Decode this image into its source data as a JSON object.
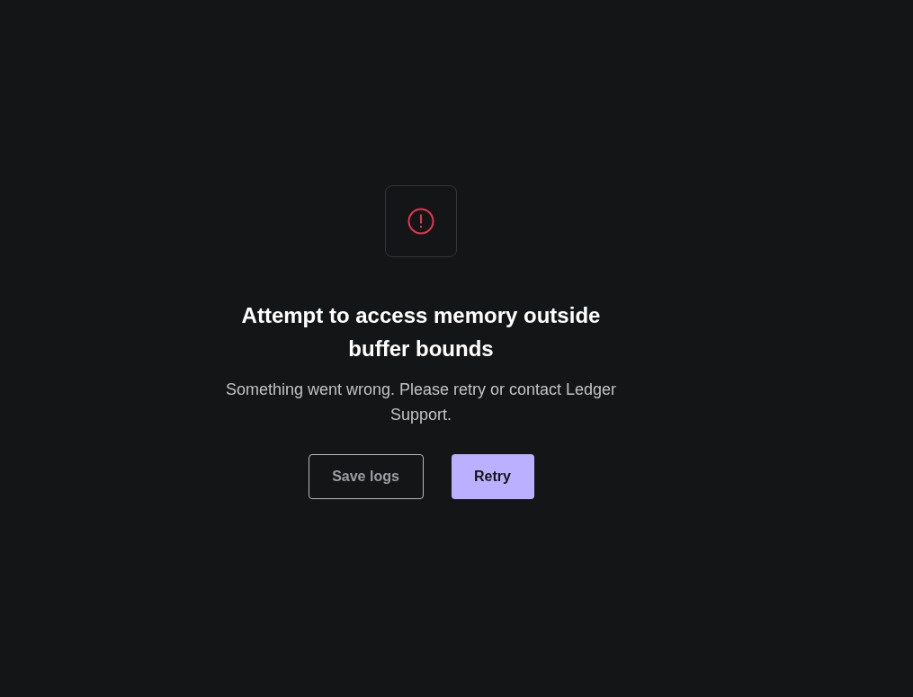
{
  "error": {
    "title": "Attempt to access memory outside buffer bounds",
    "message": "Something went wrong. Please retry or contact Ledger Support."
  },
  "buttons": [
    {
      "label": "Save logs",
      "kind": "secondary"
    },
    {
      "label": "Retry",
      "kind": "primary"
    }
  ]
}
